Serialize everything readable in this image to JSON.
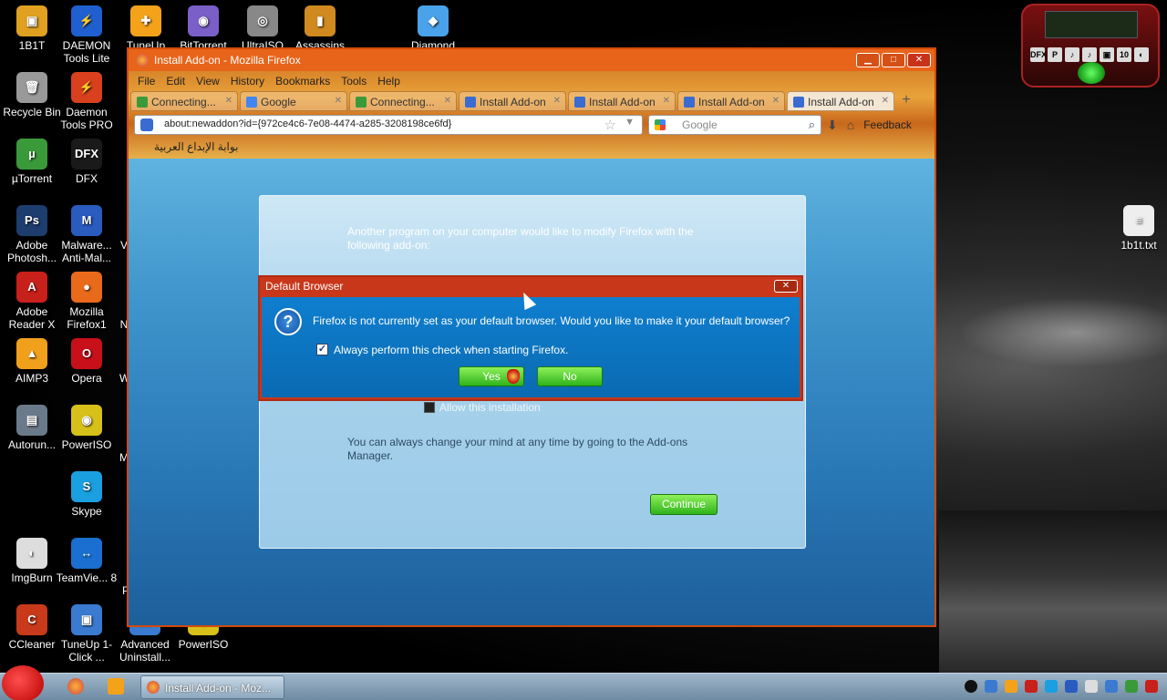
{
  "desktop": {
    "icons": [
      {
        "label": "1B1T",
        "glyph": "▣",
        "color": "#e0a020"
      },
      {
        "label": "DAEMON Tools Lite",
        "glyph": "⚡",
        "color": "#1f5fcf"
      },
      {
        "label": "TuneUp",
        "glyph": "✚",
        "color": "#f4a21a"
      },
      {
        "label": "BitTorrent",
        "glyph": "◉",
        "color": "#7a5fc8"
      },
      {
        "label": "UltraISO",
        "glyph": "◎",
        "color": "#888"
      },
      {
        "label": "Assassins",
        "glyph": "▮",
        "color": "#d08a20"
      },
      {
        "label": "Diamond",
        "glyph": "◆",
        "color": "#4aa3ea"
      },
      {
        "label": "Recycle Bin",
        "glyph": "🗑",
        "color": "#999"
      },
      {
        "label": "Daemon Tools PRO",
        "glyph": "⚡",
        "color": "#d9401e"
      },
      {
        "label": "µTorrent",
        "glyph": "µ",
        "color": "#3a9a3a"
      },
      {
        "label": "DFX",
        "glyph": "DFX",
        "color": "#1a1a1a"
      },
      {
        "label": "Adobe Photosh...",
        "glyph": "Ps",
        "color": "#1c3d6e"
      },
      {
        "label": "Malware... Anti-Mal...",
        "glyph": "M",
        "color": "#2a5bbf"
      },
      {
        "label": "Adobe Reader X",
        "glyph": "A",
        "color": "#c8201a"
      },
      {
        "label": "Mozilla Firefox1",
        "glyph": "●",
        "color": "#e86a1a"
      },
      {
        "label": "AIMP3",
        "glyph": "▲",
        "color": "#f0a01a"
      },
      {
        "label": "Opera",
        "glyph": "O",
        "color": "#c8101a"
      },
      {
        "label": "Autorun...",
        "glyph": "▤",
        "color": "#6a7a8a"
      },
      {
        "label": "PowerISO",
        "glyph": "◉",
        "color": "#d8c01a"
      },
      {
        "label": "Skype",
        "glyph": "S",
        "color": "#1a9fe0"
      },
      {
        "label": "ImgBurn",
        "glyph": "◐",
        "color": "#ddd"
      },
      {
        "label": "TeamVie... 8",
        "glyph": "↔",
        "color": "#1a6fd0"
      },
      {
        "label": "CCleaner",
        "glyph": "C",
        "color": "#c83a1a"
      },
      {
        "label": "TuneUp 1-Click ...",
        "glyph": "▣",
        "color": "#3a7ad0"
      },
      {
        "label": "Advanced Uninstall...",
        "glyph": "▣",
        "color": "#3a7ad0"
      },
      {
        "label": "PowerISO",
        "glyph": "◉",
        "color": "#d8c01a"
      },
      {
        "label": "1b1t.txt",
        "glyph": "≡",
        "color": "#eee"
      }
    ],
    "partial_labels": [
      "V",
      "N",
      "W",
      "M",
      "P"
    ]
  },
  "widget": {
    "buttons": [
      "DFX",
      "P",
      "♪",
      "♪",
      "▣",
      "10",
      "◐"
    ]
  },
  "window": {
    "title": "Install Add-on - Mozilla Firefox",
    "minimize": "▁",
    "maximize": "□",
    "close": "✕",
    "menu": [
      "File",
      "Edit",
      "View",
      "History",
      "Bookmarks",
      "Tools",
      "Help"
    ],
    "tabs": [
      {
        "label": "Connecting...",
        "icon_color": "#3a9a3a",
        "active": false
      },
      {
        "label": "Google",
        "icon_color": "#4285f4",
        "active": false
      },
      {
        "label": "Connecting...",
        "icon_color": "#3a9a3a",
        "active": false
      },
      {
        "label": "Install Add-on",
        "icon_color": "#3a6bd0",
        "active": false
      },
      {
        "label": "Install Add-on",
        "icon_color": "#3a6bd0",
        "active": false
      },
      {
        "label": "Install Add-on",
        "icon_color": "#3a6bd0",
        "active": false
      },
      {
        "label": "Install Add-on",
        "icon_color": "#3a6bd0",
        "active": true
      }
    ],
    "new_tab": "+",
    "url": "about:newaddon?id={972ce4c6-7e08-4474-a285-3208198ce6fd}",
    "search_placeholder": "Google",
    "feedback": "Feedback",
    "bookmark": "بوابة الإبداع العربية"
  },
  "addon_page": {
    "intro": "Another program on your computer would like to modify Firefox with the following add-on:",
    "allow_label": "Allow this installation",
    "note": "You can always change your mind at any time by going to the Add-ons Manager.",
    "continue": "Continue"
  },
  "dialog": {
    "title": "Default Browser",
    "close": "✕",
    "question_glyph": "?",
    "message": "Firefox is not currently set as your default browser. Would you like to make it your default browser?",
    "checkbox_label": "Always perform this check when starting Firefox.",
    "checked": true,
    "yes": "Yes",
    "no": "No"
  },
  "taskbar": {
    "task_label": "Install Add-on - Moz..."
  }
}
